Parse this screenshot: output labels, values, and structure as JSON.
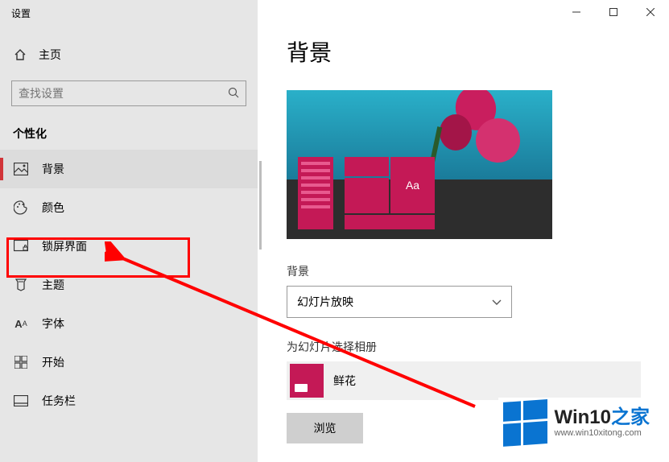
{
  "window": {
    "title": "设置"
  },
  "sidebar": {
    "home_label": "主页",
    "search_placeholder": "查找设置",
    "category_label": "个性化",
    "items": [
      {
        "label": "背景"
      },
      {
        "label": "颜色"
      },
      {
        "label": "锁屏界面"
      },
      {
        "label": "主题"
      },
      {
        "label": "字体"
      },
      {
        "label": "开始"
      },
      {
        "label": "任务栏"
      }
    ]
  },
  "content": {
    "heading": "背景",
    "preview_tile_text": "Aa",
    "bg_label": "背景",
    "bg_select_value": "幻灯片放映",
    "album_label": "为幻灯片选择相册",
    "album_name": "鲜花",
    "browse_label": "浏览"
  },
  "watermark": {
    "text_main_a": "Win10",
    "text_main_b": "之家",
    "url": "www.win10xitong.com"
  }
}
